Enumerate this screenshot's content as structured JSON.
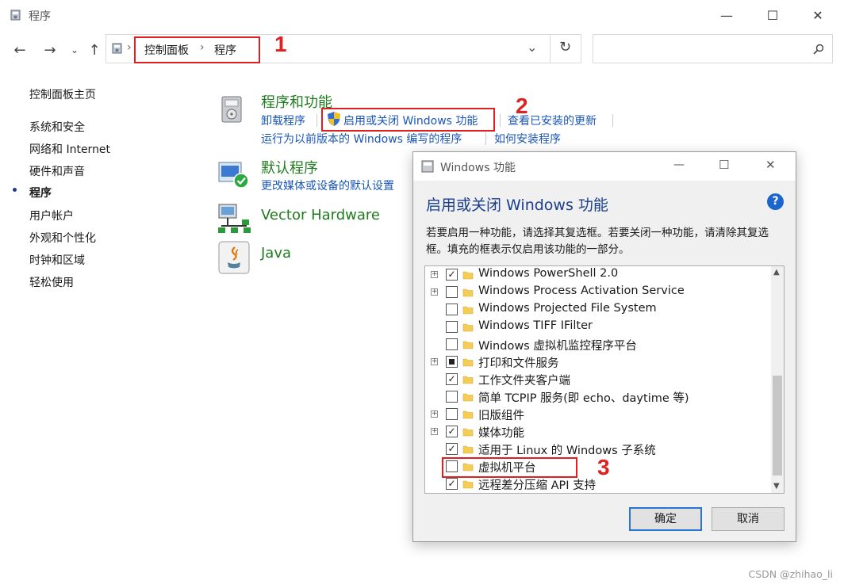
{
  "window": {
    "title": "程序"
  },
  "nav": {
    "back": "←",
    "forward": "→",
    "recent": "⌄",
    "up": "↑"
  },
  "address": {
    "crumb1": "控制面板",
    "sep": "›",
    "crumb2": "程序",
    "refresh": "↻",
    "dropdown": "⌄"
  },
  "search": {
    "placeholder": ""
  },
  "sidebar": {
    "home": "控制面板主页",
    "items": [
      {
        "label": "系统和安全"
      },
      {
        "label": "网络和 Internet"
      },
      {
        "label": "硬件和声音"
      },
      {
        "label": "程序"
      },
      {
        "label": "用户帐户"
      },
      {
        "label": "外观和个性化"
      },
      {
        "label": "时钟和区域"
      },
      {
        "label": "轻松使用"
      }
    ]
  },
  "categories": {
    "programs": {
      "title": "程序和功能",
      "link_uninstall": "卸载程序",
      "link_features": "启用或关闭 Windows 功能",
      "link_updates": "查看已安装的更新",
      "link_compat": "运行为以前版本的 Windows 编写的程序",
      "link_install": "如何安装程序"
    },
    "defaults": {
      "title": "默认程序",
      "link": "更改媒体或设备的默认设置"
    },
    "vector": {
      "title": "Vector Hardware"
    },
    "java": {
      "title": "Java"
    }
  },
  "annotations": {
    "n1": "1",
    "n2": "2",
    "n3": "3"
  },
  "dialog": {
    "title": "Windows 功能",
    "heading": "启用或关闭 Windows 功能",
    "help": "?",
    "description": "若要启用一种功能，请选择其复选框。若要关闭一种功能，请清除其复选框。填充的框表示仅启用该功能的一部分。",
    "features": [
      {
        "label": "Windows PowerShell 2.0",
        "expandable": true,
        "state": "checked"
      },
      {
        "label": "Windows Process Activation Service",
        "expandable": true,
        "state": "unchecked"
      },
      {
        "label": "Windows Projected File System",
        "expandable": false,
        "state": "unchecked"
      },
      {
        "label": "Windows TIFF IFilter",
        "expandable": false,
        "state": "unchecked"
      },
      {
        "label": "Windows 虚拟机监控程序平台",
        "expandable": false,
        "state": "unchecked"
      },
      {
        "label": "打印和文件服务",
        "expandable": true,
        "state": "partial"
      },
      {
        "label": "工作文件夹客户端",
        "expandable": false,
        "state": "checked"
      },
      {
        "label": "简单 TCPIP 服务(即 echo、daytime 等)",
        "expandable": false,
        "state": "unchecked"
      },
      {
        "label": "旧版组件",
        "expandable": true,
        "state": "unchecked"
      },
      {
        "label": "媒体功能",
        "expandable": true,
        "state": "checked"
      },
      {
        "label": "适用于 Linux 的 Windows 子系统",
        "expandable": false,
        "state": "checked"
      },
      {
        "label": "虚拟机平台",
        "expandable": false,
        "state": "unchecked"
      },
      {
        "label": "远程差分压缩 API 支持",
        "expandable": false,
        "state": "checked"
      }
    ],
    "ok": "确定",
    "cancel": "取消"
  },
  "watermark": "CSDN @zhihao_li",
  "colors": {
    "link": "#1a56b8",
    "category": "#1e7b1e",
    "annotation": "#e02020",
    "dialog_heading": "#1a3e8c"
  }
}
